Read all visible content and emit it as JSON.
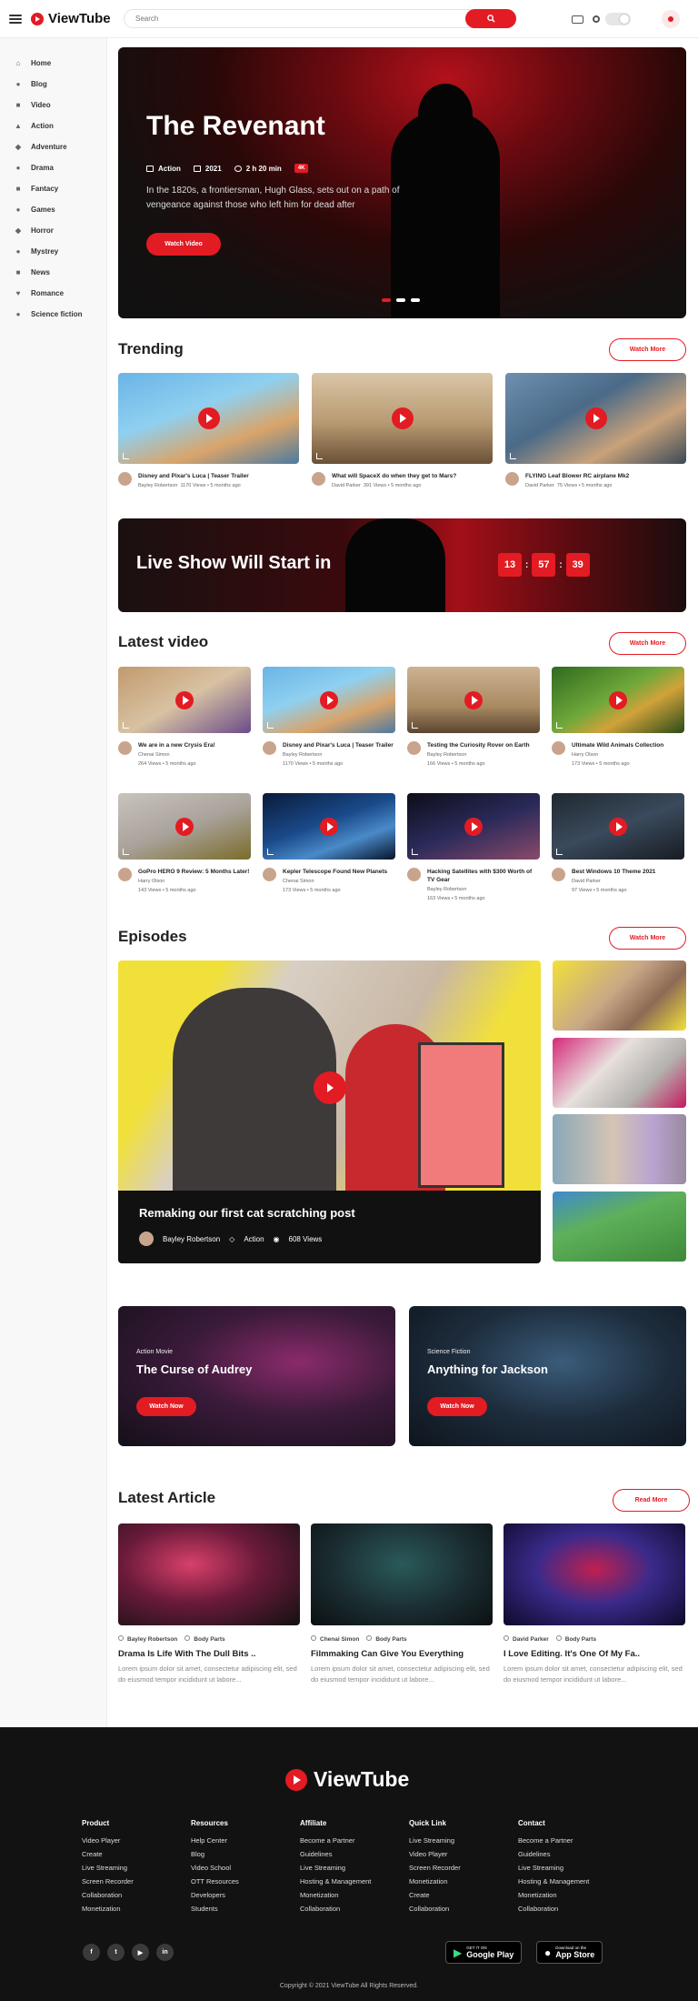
{
  "header": {
    "logo": "ViewTube",
    "search_placeholder": "Search"
  },
  "sidebar": {
    "items": [
      {
        "label": "Home",
        "icon": "home-icon",
        "glyph": "⌂"
      },
      {
        "label": "Blog",
        "icon": "blog-icon",
        "glyph": "●"
      },
      {
        "label": "Video",
        "icon": "video-icon",
        "glyph": "■"
      },
      {
        "label": "Action",
        "icon": "action-icon",
        "glyph": "▲"
      },
      {
        "label": "Adventure",
        "icon": "adventure-icon",
        "glyph": "◆"
      },
      {
        "label": "Drama",
        "icon": "drama-icon",
        "glyph": "●"
      },
      {
        "label": "Fantacy",
        "icon": "fantasy-icon",
        "glyph": "■"
      },
      {
        "label": "Games",
        "icon": "games-icon",
        "glyph": "●"
      },
      {
        "label": "Horror",
        "icon": "horror-icon",
        "glyph": "◆"
      },
      {
        "label": "Mystrey",
        "icon": "mystery-icon",
        "glyph": "●"
      },
      {
        "label": "News",
        "icon": "news-icon",
        "glyph": "■"
      },
      {
        "label": "Romance",
        "icon": "romance-icon",
        "glyph": "♥"
      },
      {
        "label": "Science fiction",
        "icon": "science-icon",
        "glyph": "●"
      }
    ]
  },
  "hero": {
    "title": "The Revenant",
    "genre": "Action",
    "year": "2021",
    "duration": "2 h 20 min",
    "badge": "4K",
    "description": "In the 1820s, a frontiersman, Hugh Glass, sets out on a path of vengeance against those who left him for dead after",
    "button": "Watch Video"
  },
  "trending": {
    "title": "Trending",
    "more": "Watch More",
    "items": [
      {
        "title": "Disney and Pixar's Luca | Teaser Trailer",
        "author": "Bayley Robertson",
        "stats": "1170 Views  •  5 months ago"
      },
      {
        "title": "What will SpaceX do when they get to Mars?",
        "author": "David Parker",
        "stats": "391 Views  •  5 months ago"
      },
      {
        "title": "FLYING Leaf Blower RC airplane Mk2",
        "author": "David Parker",
        "stats": "75 Views  •  5 months ago"
      }
    ]
  },
  "live": {
    "title": "Live Show Will Start in",
    "hours": "13",
    "minutes": "57",
    "seconds": "39"
  },
  "latest": {
    "title": "Latest video",
    "more": "Watch More",
    "items": [
      {
        "title": "We are in a new Crysis Era!",
        "author": "Chenai Simon",
        "stats": "264 Views  •  5 months ago"
      },
      {
        "title": "Disney and Pixar's Luca | Teaser Trailer",
        "author": "Bayley Robertson",
        "stats": "1170 Views  •  5 months ago"
      },
      {
        "title": "Testing the Curiosity Rover on Earth",
        "author": "Bayley Robertson",
        "stats": "166 Views  •  5 months ago"
      },
      {
        "title": "Ultimate Wild Animals Collection",
        "author": "Harry Olson",
        "stats": "173 Views  •  5 months ago"
      },
      {
        "title": "GoPro HERO 9 Review: 5 Months Later!",
        "author": "Harry Olson",
        "stats": "143 Views  •  5 months ago"
      },
      {
        "title": "Kepler Telescope Found New Planets",
        "author": "Chenai Simon",
        "stats": "173 Views  •  5 months ago"
      },
      {
        "title": "Hacking Satellites with $300 Worth of TV Gear",
        "author": "Bayley Robertson",
        "stats": "163 Views  •  5 months ago"
      },
      {
        "title": "Best Windows 10 Theme 2021",
        "author": "David Parker",
        "stats": "97 Views  •  5 months ago"
      }
    ]
  },
  "episodes": {
    "title": "Episodes",
    "more": "Watch More",
    "featured": {
      "title": "Remaking our first cat scratching post",
      "author": "Bayley Robertson",
      "category": "Action",
      "views": "608 Views"
    }
  },
  "promos": [
    {
      "kicker": "Action Movie",
      "title": "The Curse of Audrey",
      "button": "Watch Now"
    },
    {
      "kicker": "Science Fiction",
      "title": "Anything for Jackson",
      "button": "Watch Now"
    }
  ],
  "articles": {
    "title": "Latest Article",
    "more": "Read More",
    "items": [
      {
        "author": "Bayley Robertson",
        "tag": "Body Parts",
        "title": "Drama Is Life With The Dull Bits ..",
        "excerpt": "Lorem ipsum dolor sit amet, consectetur adipiscing elit, sed do eiusmod tempor incididunt ut labore..."
      },
      {
        "author": "Chenai Simon",
        "tag": "Body Parts",
        "title": "Filmmaking Can Give You Everything",
        "excerpt": "Lorem ipsum dolor sit amet, consectetur adipiscing elit, sed do eiusmod tempor incididunt ut labore..."
      },
      {
        "author": "David Parker",
        "tag": "Body Parts",
        "title": "I Love Editing. It's One Of My Fa..",
        "excerpt": "Lorem ipsum dolor sit amet, consectetur adipiscing elit, sed do eiusmod tempor incididunt ut labore..."
      }
    ]
  },
  "footer": {
    "logo": "ViewTube",
    "columns": [
      {
        "title": "Product",
        "links": [
          "Video Player",
          "Create",
          "Live Streaming",
          "Screen Recorder",
          "Collaboration",
          "Monetization"
        ]
      },
      {
        "title": "Resources",
        "links": [
          "Help Center",
          "Blog",
          "Video School",
          "OTT Resources",
          "Developers",
          "Students"
        ]
      },
      {
        "title": "Affiliate",
        "links": [
          "Become a Partner",
          "Guidelines",
          "Live Streaming",
          "Hosting & Management",
          "Monetization",
          "Collaboration"
        ]
      },
      {
        "title": "Quick Link",
        "links": [
          "Live Streaming",
          "Video Player",
          "Screen Recorder",
          "Monetization",
          "Create",
          "Collaboration"
        ]
      },
      {
        "title": "Contact",
        "links": [
          "Become a Partner",
          "Guidelines",
          "Live Streaming",
          "Hosting & Management",
          "Monetization",
          "Collaboration"
        ]
      }
    ],
    "google_small": "GET IT ON",
    "google_big": "Google Play",
    "apple_small": "Download on the",
    "apple_big": "App Store",
    "copyright": "Copyright © 2021 ViewTube All Rights Reserved."
  },
  "colors": {
    "accent": "#e31b23",
    "footer_bg": "#121212",
    "sidebar_bg": "#f8f8f8"
  }
}
